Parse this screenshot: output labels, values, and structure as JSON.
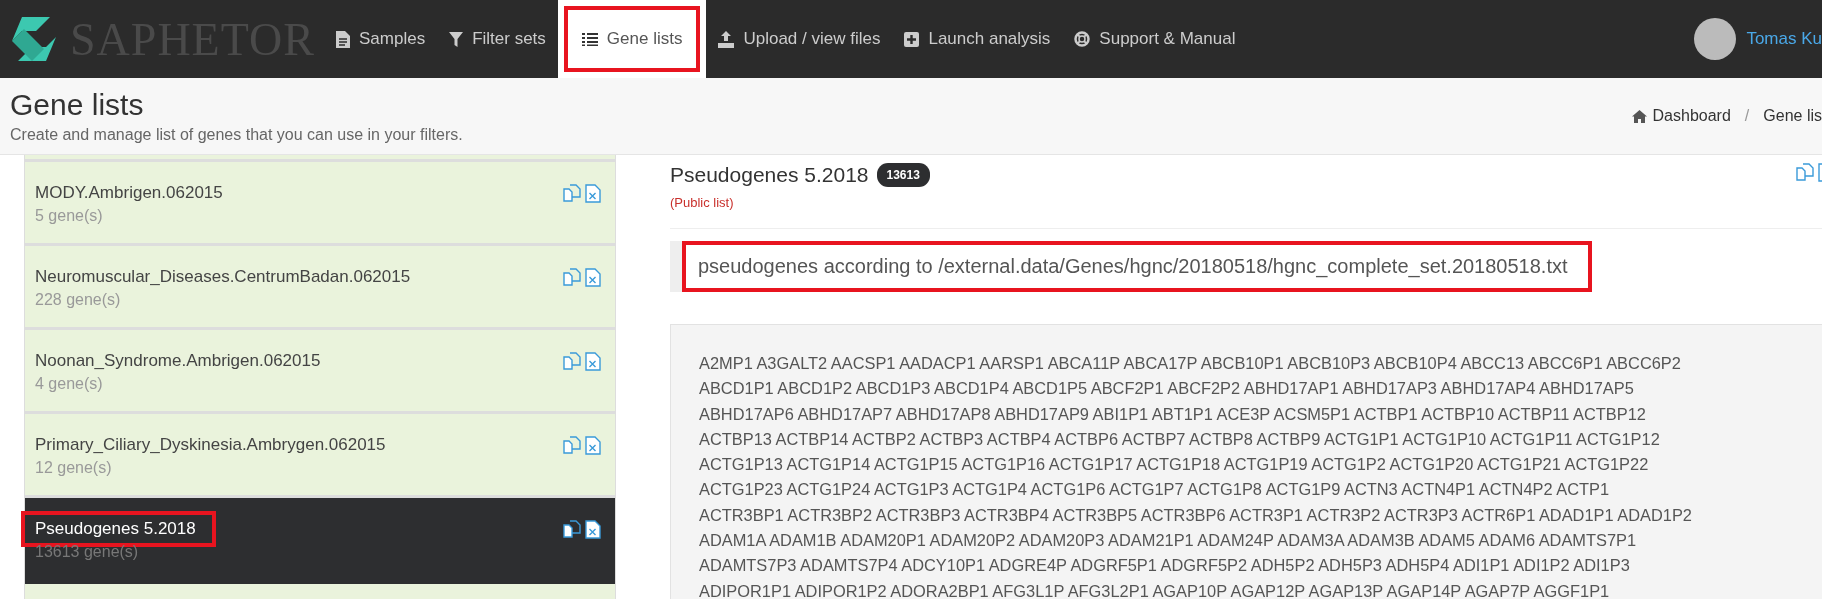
{
  "navbar": {
    "logo": "SAPHETOR",
    "items": [
      {
        "label": "Samples",
        "kind": "doc",
        "selected": false,
        "highlighted": false
      },
      {
        "label": "Filter sets",
        "kind": "filter",
        "selected": false,
        "highlighted": false
      },
      {
        "label": "Gene lists",
        "kind": "list",
        "selected": true,
        "highlighted": true
      },
      {
        "label": "Upload / view files",
        "kind": "upload",
        "selected": false,
        "highlighted": false
      },
      {
        "label": "Launch analysis",
        "kind": "plus",
        "selected": false,
        "highlighted": false
      },
      {
        "label": "Support & Manual",
        "kind": "lifebuoy",
        "selected": false,
        "highlighted": false
      }
    ],
    "user": "Tomas Ku"
  },
  "header": {
    "title": "Gene lists",
    "subtitle": "Create and manage list of genes that you can use in your filters.",
    "breadcrumbs": [
      {
        "label": "Dashboard",
        "kind": "home"
      },
      {
        "label": "/",
        "kind": "separator"
      },
      {
        "label": "Gene lis",
        "kind": "current"
      }
    ]
  },
  "gene_lists": [
    {
      "name": "MODY.Ambrigen.062015",
      "count": "5 gene(s)",
      "selected": false,
      "highlighted": false
    },
    {
      "name": "Neuromuscular_Diseases.CentrumBadan.062015",
      "count": "228 gene(s)",
      "selected": false,
      "highlighted": false
    },
    {
      "name": "Noonan_Syndrome.Ambrigen.062015",
      "count": "4 gene(s)",
      "selected": false,
      "highlighted": false
    },
    {
      "name": "Primary_Ciliary_Dyskinesia.Ambrygen.062015",
      "count": "12 gene(s)",
      "selected": false,
      "highlighted": false
    },
    {
      "name": "Pseudogenes 5.2018",
      "count": "13613 gene(s)",
      "selected": true,
      "highlighted": true
    }
  ],
  "detail": {
    "title": "Pseudogenes 5.2018",
    "count": "13613",
    "visibility": "(Public list)",
    "description": "pseudogenes according to /external.data/Genes/hgnc/20180518/hgnc_complete_set.20180518.txt",
    "description_highlighted": true,
    "gene_lines": [
      "A2MP1 A3GALT2 AACSP1 AADACP1 AARSP1 ABCA11P ABCA17P ABCB10P1 ABCB10P3 ABCB10P4 ABCC13 ABCC6P1 ABCC6P2",
      "ABCD1P1 ABCD1P2 ABCD1P3 ABCD1P4 ABCD1P5 ABCF2P1 ABCF2P2 ABHD17AP1 ABHD17AP3 ABHD17AP4 ABHD17AP5",
      "ABHD17AP6 ABHD17AP7 ABHD17AP8 ABHD17AP9 ABI1P1 ABT1P1 ACE3P ACSM5P1 ACTBP1 ACTBP10 ACTBP11 ACTBP12",
      "ACTBP13 ACTBP14 ACTBP2 ACTBP3 ACTBP4 ACTBP6 ACTBP7 ACTBP8 ACTBP9 ACTG1P1 ACTG1P10 ACTG1P11 ACTG1P12",
      "ACTG1P13 ACTG1P14 ACTG1P15 ACTG1P16 ACTG1P17 ACTG1P18 ACTG1P19 ACTG1P2 ACTG1P20 ACTG1P21 ACTG1P22",
      "ACTG1P23 ACTG1P24 ACTG1P3 ACTG1P4 ACTG1P6 ACTG1P7 ACTG1P8 ACTG1P9 ACTN3 ACTN4P1 ACTN4P2 ACTP1",
      "ACTR3BP1 ACTR3BP2 ACTR3BP3 ACTR3BP4 ACTR3BP5 ACTR3BP6 ACTR3P1 ACTR3P2 ACTR3P3 ACTR6P1 ADAD1P1 ADAD1P2",
      "ADAM1A ADAM1B ADAM20P1 ADAM20P2 ADAM20P3 ADAM21P1 ADAM24P ADAM3A ADAM3B ADAM5 ADAM6 ADAMTS7P1",
      "ADAMTS7P3 ADAMTS7P4 ADCY10P1 ADGRE4P ADGRF5P1 ADGRF5P2 ADH5P2 ADH5P3 ADH5P4 ADI1P1 ADI1P2 ADI1P3",
      "ADIPOR1P1 ADIPOR1P2 ADORA2BP1 AFG3L1P AFG3L2P1 AGAP10P AGAP12P AGAP13P AGAP14P AGAP7P AGGF1P1"
    ]
  }
}
